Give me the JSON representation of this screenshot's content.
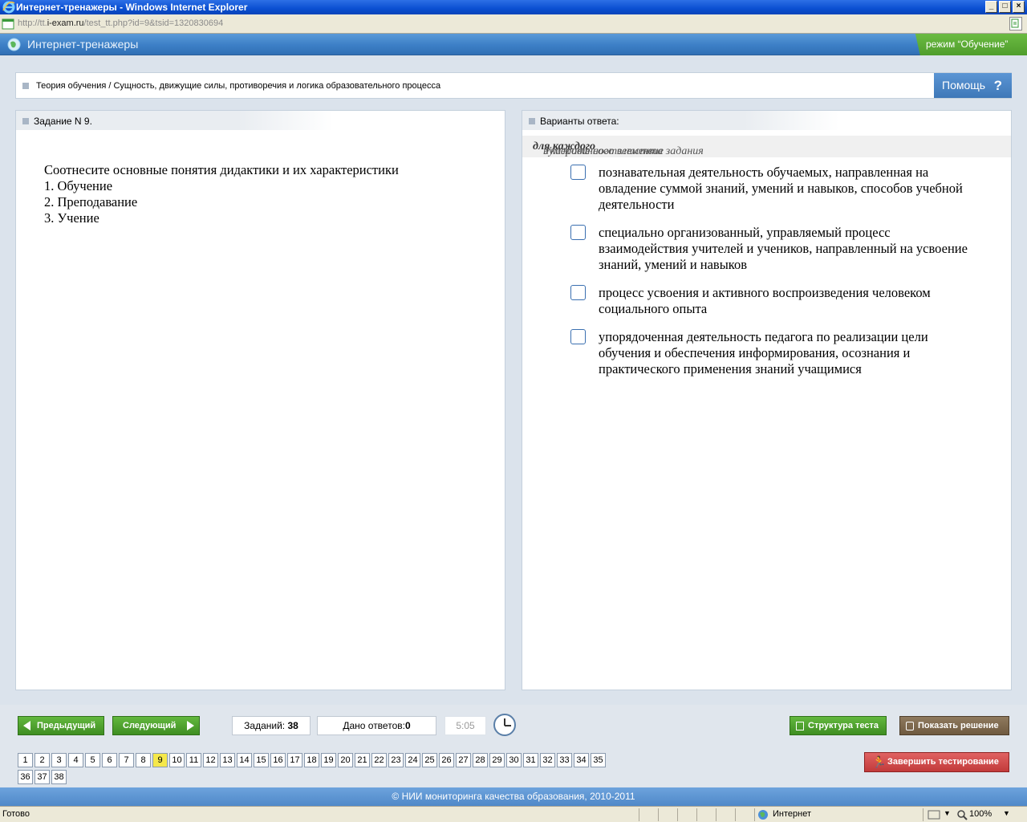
{
  "window": {
    "title": "Интернет-тренажеры - Windows Internet Explorer",
    "url_prefix": "http://tt.",
    "url_host": "i-exam.ru",
    "url_path": "/test_tt.php?id=9&tsid=1320830694",
    "btn_min": "_",
    "btn_max": "□",
    "btn_close": "×"
  },
  "app": {
    "title": "Интернет-тренажеры",
    "mode": "режим “Обучение”"
  },
  "breadcrumb": "Теория обучения / Сущность, движущие силы, противоречия и логика образовательного процесса",
  "help": {
    "label": "Помощь",
    "icon": "?"
  },
  "task": {
    "header": "Задание N 9.",
    "question_lines": [
      "Соотнесите основные понятия дидактики  и их характеристики",
      "1. Обучение",
      "2. Преподавание",
      "3. Учение"
    ]
  },
  "answers": {
    "header": "Варианты ответа:",
    "hint_before": "Укажите соответствие ",
    "hint_bold": "для каждого",
    "hint_after": " нумерованного элемента задания",
    "options": [
      "познавательная деятельность обучаемых, направленная на овладение суммой знаний, умений и навыков, способов учебной деятельности",
      "специально организованный, управляемый процесс взаимодействия учителей и учеников, направленный на усвоение знаний, умений и навыков",
      "процесс усвоения и активного воспроизведения человеком социального опыта",
      "упорядоченная деятельность педагога по реализации цели обучения и обеспечения информирования, осознания и практического применения знаний учащимися"
    ]
  },
  "nav": {
    "prev": "Предыдущий",
    "next": "Следующий",
    "tasks_label": "Заданий:",
    "tasks_count": "38",
    "answers_label": "Дано ответов:",
    "answers_count": "0",
    "timer": "5:05",
    "structure": "Структура теста",
    "solution": "Показать решение",
    "finish": "Завершить тестирование",
    "current_page": 9,
    "pages": [
      "1",
      "2",
      "3",
      "4",
      "5",
      "6",
      "7",
      "8",
      "9",
      "10",
      "11",
      "12",
      "13",
      "14",
      "15",
      "16",
      "17",
      "18",
      "19",
      "20",
      "21",
      "22",
      "23",
      "24",
      "25",
      "26",
      "27",
      "28",
      "29",
      "30",
      "31",
      "32",
      "33",
      "34",
      "35",
      "36",
      "37",
      "38"
    ]
  },
  "footer": "© НИИ мониторинга качества образования, 2010-2011",
  "status": {
    "left": "Готово",
    "zone": "Интернет",
    "zoom": "100%"
  }
}
